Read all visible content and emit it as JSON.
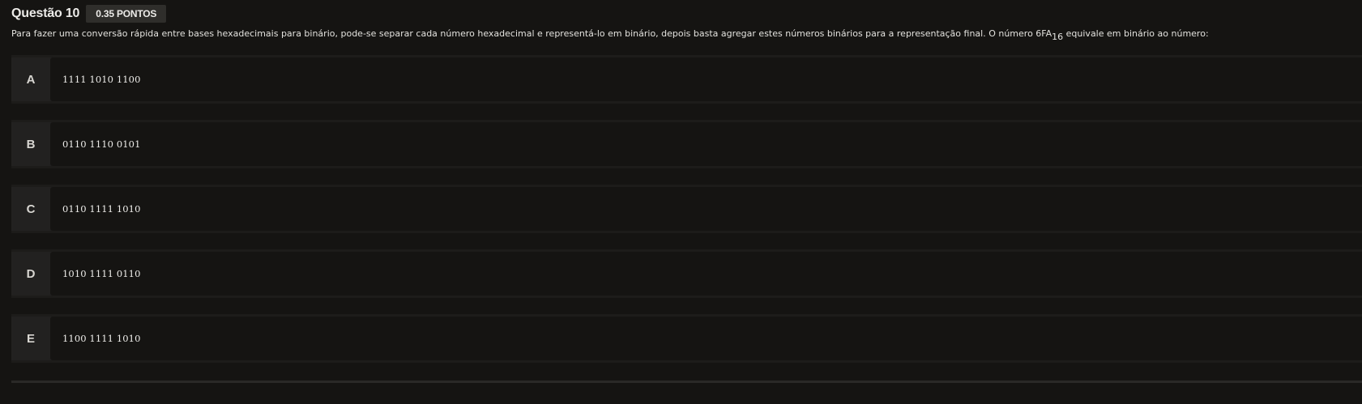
{
  "question": {
    "title": "Questão 10",
    "points": "0.35 PONTOS",
    "text_before": "Para fazer uma conversão rápida entre bases hexadecimais para binário, pode-se separar cada número hexadecimal e representá-lo em binário, depois basta agregar estes números binários para a representação final. O número 6FA",
    "text_subscript": "16",
    "text_after": " equivale em binário ao número:"
  },
  "options": [
    {
      "letter": "A",
      "text": "1111 1010 1100"
    },
    {
      "letter": "B",
      "text": "0110 1110 0101"
    },
    {
      "letter": "C",
      "text": "0110 1111 1010"
    },
    {
      "letter": "D",
      "text": "1010 1111 0110"
    },
    {
      "letter": "E",
      "text": "1100 1111 1010"
    }
  ]
}
